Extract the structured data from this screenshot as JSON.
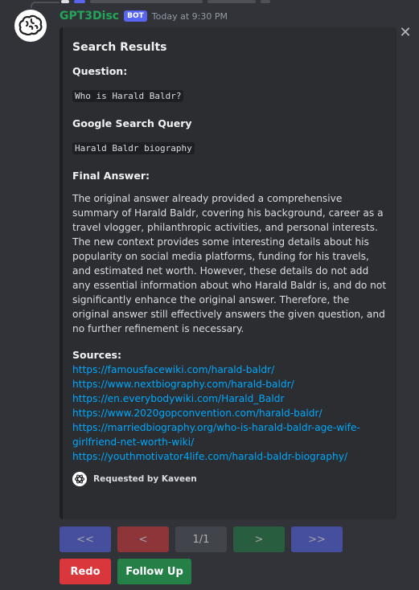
{
  "message": {
    "username": "GPT3Disc",
    "badge": "BOT",
    "timestamp": "Today at 9:30 PM"
  },
  "embed": {
    "title": "Search Results",
    "question_label": "Question:",
    "question": "Who is Harald Baldr?",
    "query_label": "Google Search Query",
    "query": "Harald Baldr biography",
    "answer_label": "Final Answer:",
    "answer": "The original answer already provided a comprehensive summary of Harald Baldr, covering his background, career as a travel vlogger, philanthropic activities, and personal interests. The new context provides some interesting details about his popularity on social media platforms, funding for his travels, and estimated net worth. However, these details do not add any essential information about who Harald Baldr is, and do not significantly enhance the original answer. Therefore, the original answer still effectively answers the given question, and no further refinement is necessary.",
    "sources_label": "Sources:",
    "sources": [
      "https://famousfacewiki.com/harald-baldr/",
      "https://www.nextbiography.com/harald-baldr/",
      "https://en.everybodywiki.com/Harald_Baldr",
      "https://www.2020gopconvention.com/harald-baldr/",
      "https://marriedbiography.org/who-is-harald-baldr-age-wife-girlfriend-net-worth-wiki/",
      "https://youthmotivator4life.com/harald-baldr-biography/"
    ],
    "footer": "Requested by Kaveen"
  },
  "pagination": {
    "first": "<<",
    "prev": "<",
    "page": "1/1",
    "next": ">",
    "last": ">>"
  },
  "actions": {
    "redo": "Redo",
    "follow_up": "Follow Up"
  },
  "colors": {
    "background": "#313338",
    "embed": "#2b2d31",
    "username": "#23a55a",
    "badge": "#5865f2",
    "link": "#00a8fc",
    "redo": "#da373c",
    "follow_up": "#248046"
  },
  "icons": {
    "avatar": "brain-icon",
    "close": "close-icon",
    "footer": "openai-logo-icon"
  }
}
